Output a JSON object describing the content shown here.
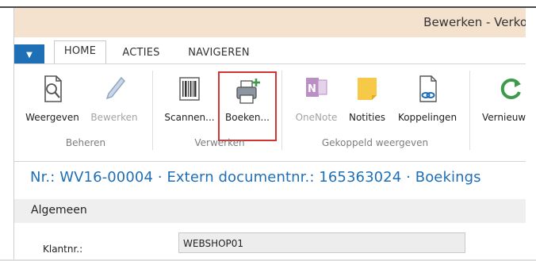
{
  "window": {
    "title": "Bewerken - Verko"
  },
  "tabs": [
    {
      "label": "HOME",
      "active": true
    },
    {
      "label": "ACTIES",
      "active": false
    },
    {
      "label": "NAVIGEREN",
      "active": false
    }
  ],
  "ribbon": {
    "buttons": [
      {
        "label": "Weergeven",
        "icon": "magnifier-document-icon",
        "enabled": true
      },
      {
        "label": "Bewerken",
        "icon": "pencil-icon",
        "enabled": false
      },
      {
        "label": "Scannen...",
        "icon": "barcode-icon",
        "enabled": true
      },
      {
        "label": "Boeken...",
        "icon": "post-printer-icon",
        "enabled": true,
        "highlighted": true
      },
      {
        "label": "OneNote",
        "icon": "onenote-icon",
        "enabled": false
      },
      {
        "label": "Notities",
        "icon": "note-icon",
        "enabled": true
      },
      {
        "label": "Koppelingen",
        "icon": "links-icon",
        "enabled": true
      },
      {
        "label": "Vernieuw",
        "icon": "refresh-icon",
        "enabled": true
      }
    ],
    "groups": [
      "Beheren",
      "Verwerken",
      "Gekoppeld weergeven"
    ]
  },
  "page": {
    "title": "Nr.: WV16-00004 · Extern documentnr.: 165363024 · Boekings"
  },
  "section": {
    "title": "Algemeen",
    "fields": [
      {
        "label": "Klantnr.:",
        "value": "WEBSHOP01"
      }
    ]
  },
  "colors": {
    "accent": "#1f6fb6",
    "titlebar": "#f4e2cf",
    "highlight": "#d23434"
  }
}
